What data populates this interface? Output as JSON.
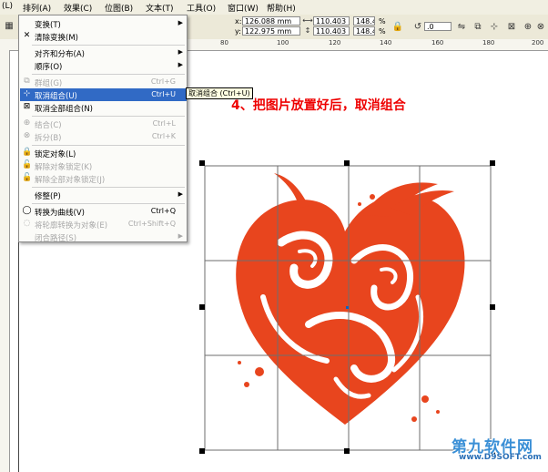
{
  "menubar": {
    "items": [
      {
        "label": "(L)"
      },
      {
        "label": "排列(A)"
      },
      {
        "label": "效果(C)"
      },
      {
        "label": "位图(B)"
      },
      {
        "label": "文本(T)"
      },
      {
        "label": "工具(O)"
      },
      {
        "label": "窗口(W)"
      },
      {
        "label": "帮助(H)"
      }
    ]
  },
  "propbar": {
    "x_label": "x:",
    "x_value": "126.088 mm",
    "y_label": "y:",
    "y_value": "122.975 mm",
    "w_value": "110.403 mm",
    "h_value": "110.403 mm",
    "sx_value": "148.4",
    "sy_value": "148.4",
    "pct1": "%",
    "pct2": "%",
    "rotation_value": ".0"
  },
  "ruler": {
    "numbers": [
      "80",
      "100",
      "120",
      "140",
      "160",
      "180",
      "200"
    ]
  },
  "dropdown": {
    "items": [
      {
        "label": "变换(T)",
        "shortcut": "",
        "submenu": true,
        "disabled": false
      },
      {
        "label": "清除变换(M)",
        "shortcut": "",
        "submenu": false,
        "disabled": false
      },
      {
        "label": "对齐和分布(A)",
        "shortcut": "",
        "submenu": true,
        "disabled": false
      },
      {
        "label": "顺序(O)",
        "shortcut": "",
        "submenu": true,
        "disabled": false
      },
      {
        "label": "群组(G)",
        "shortcut": "Ctrl+G",
        "submenu": false,
        "disabled": true
      },
      {
        "label": "取消组合(U)",
        "shortcut": "Ctrl+U",
        "submenu": false,
        "disabled": false,
        "highlighted": true
      },
      {
        "label": "取消全部组合(N)",
        "shortcut": "",
        "submenu": false,
        "disabled": false
      },
      {
        "label": "结合(C)",
        "shortcut": "Ctrl+L",
        "submenu": false,
        "disabled": true
      },
      {
        "label": "拆分(B)",
        "shortcut": "Ctrl+K",
        "submenu": false,
        "disabled": true
      },
      {
        "label": "锁定对象(L)",
        "shortcut": "",
        "submenu": false,
        "disabled": false
      },
      {
        "label": "解除对象锁定(K)",
        "shortcut": "",
        "submenu": false,
        "disabled": true
      },
      {
        "label": "解除全部对象锁定(J)",
        "shortcut": "",
        "submenu": false,
        "disabled": true
      },
      {
        "label": "修整(P)",
        "shortcut": "",
        "submenu": true,
        "disabled": false
      },
      {
        "label": "转换为曲线(V)",
        "shortcut": "Ctrl+Q",
        "submenu": false,
        "disabled": false
      },
      {
        "label": "将轮廓转换为对象(E)",
        "shortcut": "Ctrl+Shift+Q",
        "submenu": false,
        "disabled": true
      },
      {
        "label": "闭合路径(S)",
        "shortcut": "",
        "submenu": true,
        "disabled": true
      }
    ]
  },
  "tooltip": "取消组合 (Ctrl+U)",
  "instruction": "4、把图片放置好后，取消组合",
  "watermark": {
    "line1": "第九软件网",
    "line2": "www.D9SOFT.com"
  },
  "colors": {
    "heart": "#e8451e",
    "highlight": "#316ac5",
    "instruction": "#ee0000",
    "watermark": "#3a8fd6"
  }
}
